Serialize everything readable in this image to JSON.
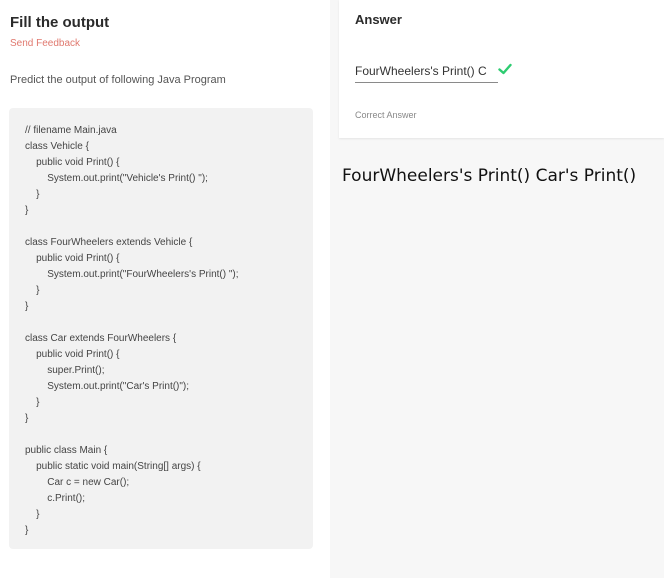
{
  "left": {
    "title": "Fill the output",
    "send_feedback": "Send Feedback",
    "question": "Predict the output of following Java Program",
    "code_lines": [
      "// filename Main.java",
      "class Vehicle {",
      "    public void Print() {",
      "        System.out.print(\"Vehicle's Print() \");",
      "    }",
      "}",
      "",
      "class FourWheelers extends Vehicle {",
      "    public void Print() {",
      "        System.out.print(\"FourWheelers's Print() \");",
      "    }",
      "}",
      "",
      "class Car extends FourWheelers {",
      "    public void Print() {",
      "        super.Print();",
      "        System.out.print(\"Car's Print()\");",
      "    }",
      "}",
      "",
      "public class Main {",
      "    public static void main(String[] args) {",
      "        Car c = new Car();",
      "        c.Print();",
      "    }",
      "}"
    ]
  },
  "answer": {
    "heading": "Answer",
    "input_value": "FourWheelers's Print() C",
    "status_icon": "check-icon",
    "status_color": "#2ecc71",
    "correct_label": "Correct Answer"
  },
  "output_text": "FourWheelers's Print() Car's Print()"
}
